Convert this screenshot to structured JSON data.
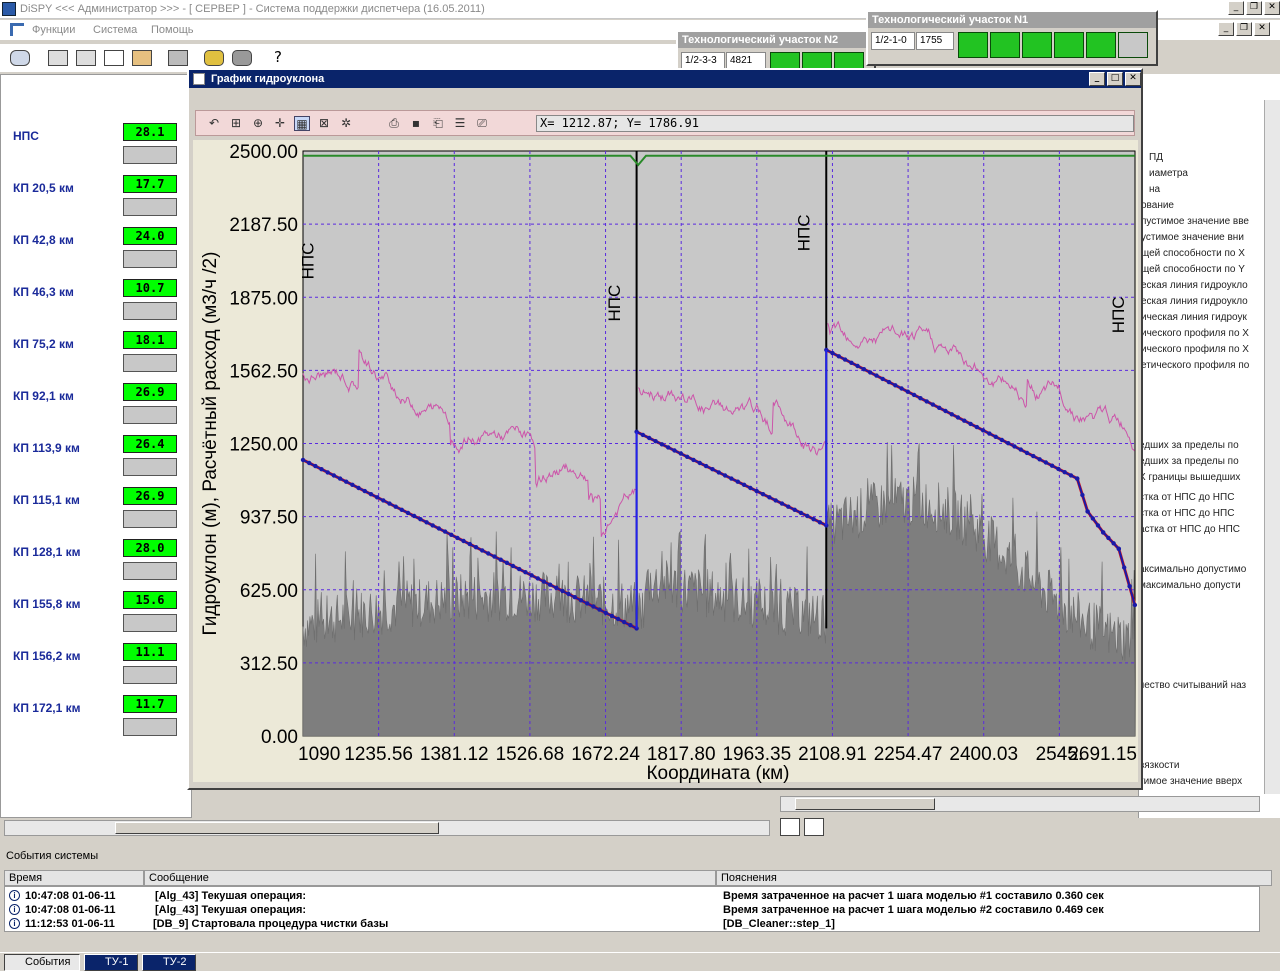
{
  "window": {
    "title": "DiSPY <<< Администратор >>> - [ СЕРВЕР ] - Система поддержки диспетчера (16.05.2011)"
  },
  "menu": [
    "Функции",
    "Система",
    "Помощь"
  ],
  "left_panel": {
    "items": [
      {
        "name": "НПС",
        "value": "28.1"
      },
      {
        "name": "КП 20,5 км",
        "value": "17.7"
      },
      {
        "name": "КП 42,8 км",
        "value": "24.0"
      },
      {
        "name": "КП 46,3 км",
        "value": "10.7"
      },
      {
        "name": "КП 75,2 км",
        "value": "18.1"
      },
      {
        "name": "КП 92,1 км",
        "value": "26.9"
      },
      {
        "name": "КП 113,9 км",
        "value": "26.4"
      },
      {
        "name": "КП 115,1 км",
        "value": "26.9"
      },
      {
        "name": "КП 128,1 км",
        "value": "28.0"
      },
      {
        "name": "КП 155,8 км",
        "value": "15.6"
      },
      {
        "name": "КП 156,2 км",
        "value": "11.1"
      },
      {
        "name": "КП 172,1 км",
        "value": "11.7"
      }
    ]
  },
  "tech_sections": {
    "n1": {
      "title": "Технологический участок N1",
      "code": "1/2-1-0",
      "value": "1755"
    },
    "n2": {
      "title": "Технологический участок N2",
      "code": "1/2-3-3",
      "value": "4821"
    }
  },
  "right_panel_lines": [
    "ПД",
    "иаметра",
    "на",
    "ование",
    "пустимое значение вве",
    "устимое значение вни",
    "щей способности по X",
    "щей способности по Y",
    "еская линия гидроукло",
    "еская линия гидроукло",
    "ическая линия гидроук",
    "ического профиля по X",
    "ического профиля по X",
    "етического профиля по",
    "едших за пределы по",
    "едших за пределы по",
    "X границы вышедших",
    "стка от НПС до НПС",
    "стка от НПС до НПС",
    "астка от НПС до НПС",
    "аксимально допустимо",
    "максимально допусти",
    "чество считываний наз",
    "вязкости",
    "тимое значение вверх"
  ],
  "graph_window": {
    "title": "График гидроуклона",
    "coord_readout": "X= 1212.87; Y= 1786.91"
  },
  "chart_data": {
    "type": "line",
    "ylabel": "Гидроуклон (м), Расчётный расход (м3/ч /2)",
    "xlabel": "Координата (км)",
    "ylim": [
      0,
      2500
    ],
    "xlim": [
      1090.0,
      2691.15
    ],
    "y_ticks": [
      "2500.00",
      "2187.50",
      "1875.00",
      "1562.50",
      "1250.00",
      "937.50",
      "625.00",
      "312.50",
      "0.00"
    ],
    "x_ticks": [
      "1090",
      "1235.56",
      "1381.12",
      "1526.68",
      "1672.24",
      "1817.80",
      "1963.35",
      "2108.91",
      "2254.47",
      "2400.03",
      "2545.59",
      "2691.15"
    ],
    "x_tick_text": [
      "1090",
      "1235.56",
      "1381.12",
      "1526.68",
      "1672.24",
      "1817.80",
      "1963.35",
      "2108.91",
      "2254.47",
      "2400.03",
      "2545.",
      "2691.15"
    ],
    "station_lines": [
      {
        "x": 1732,
        "label": "НПС"
      },
      {
        "x": 2097,
        "label": "НПС"
      }
    ],
    "station_labels": [
      {
        "x": 1110,
        "y": 2030,
        "text": "НПС"
      },
      {
        "x": 1700,
        "y": 1850,
        "text": "НПС"
      },
      {
        "x": 2065,
        "y": 2150,
        "text": "НПС"
      },
      {
        "x": 2670,
        "y": 1800,
        "text": "НПС"
      }
    ],
    "series": [
      {
        "color": "#1a1aa8",
        "segments": [
          [
            [
              1090,
              1180
            ],
            [
              1732,
              460
            ]
          ],
          [
            [
              1732,
              1300
            ],
            [
              2097,
              900
            ]
          ],
          [
            [
              2097,
              1650
            ],
            [
              2580,
              1100
            ],
            [
              2600,
              960
            ],
            [
              2630,
              870
            ],
            [
              2660,
              800
            ],
            [
              2691,
              560
            ]
          ]
        ]
      },
      {
        "color": "#2a8a2a",
        "values": [
          [
            1090,
            2480
          ],
          [
            1720,
            2480
          ],
          [
            1735,
            2440
          ],
          [
            1750,
            2480
          ],
          [
            2691,
            2480
          ]
        ]
      }
    ],
    "grid": true,
    "colors": {
      "plot_bg": "#c8c8c8",
      "profile": "#7e7e7e",
      "flow": "#cc55aa",
      "slope": "#1a1aa8",
      "fit": "#e01010",
      "pressure": "#2a8a2a",
      "grid": "#5a2ae0"
    }
  },
  "events": {
    "title": "События системы",
    "headers": [
      "Время",
      "Сообщение",
      "Пояснения"
    ],
    "rows": [
      {
        "time": "10:47:08 01-06-11",
        "msg": "[Alg_43] Текушая операция:",
        "note": "Время затраченное на расчет 1 шага моделью #1 составило 0.360 сек"
      },
      {
        "time": "10:47:08 01-06-11",
        "msg": "[Alg_43] Текушая операция:",
        "note": "Время затраченное на расчет 1 шага моделью #2 составило 0.469 сек"
      },
      {
        "time": "11:12:53 01-06-11",
        "msg": "[DB_9] Стартовала процедура чистки базы",
        "note": "[DB_Cleaner::step_1]"
      }
    ]
  },
  "taskbar": [
    "События",
    "ТУ-1",
    "ТУ-2"
  ]
}
